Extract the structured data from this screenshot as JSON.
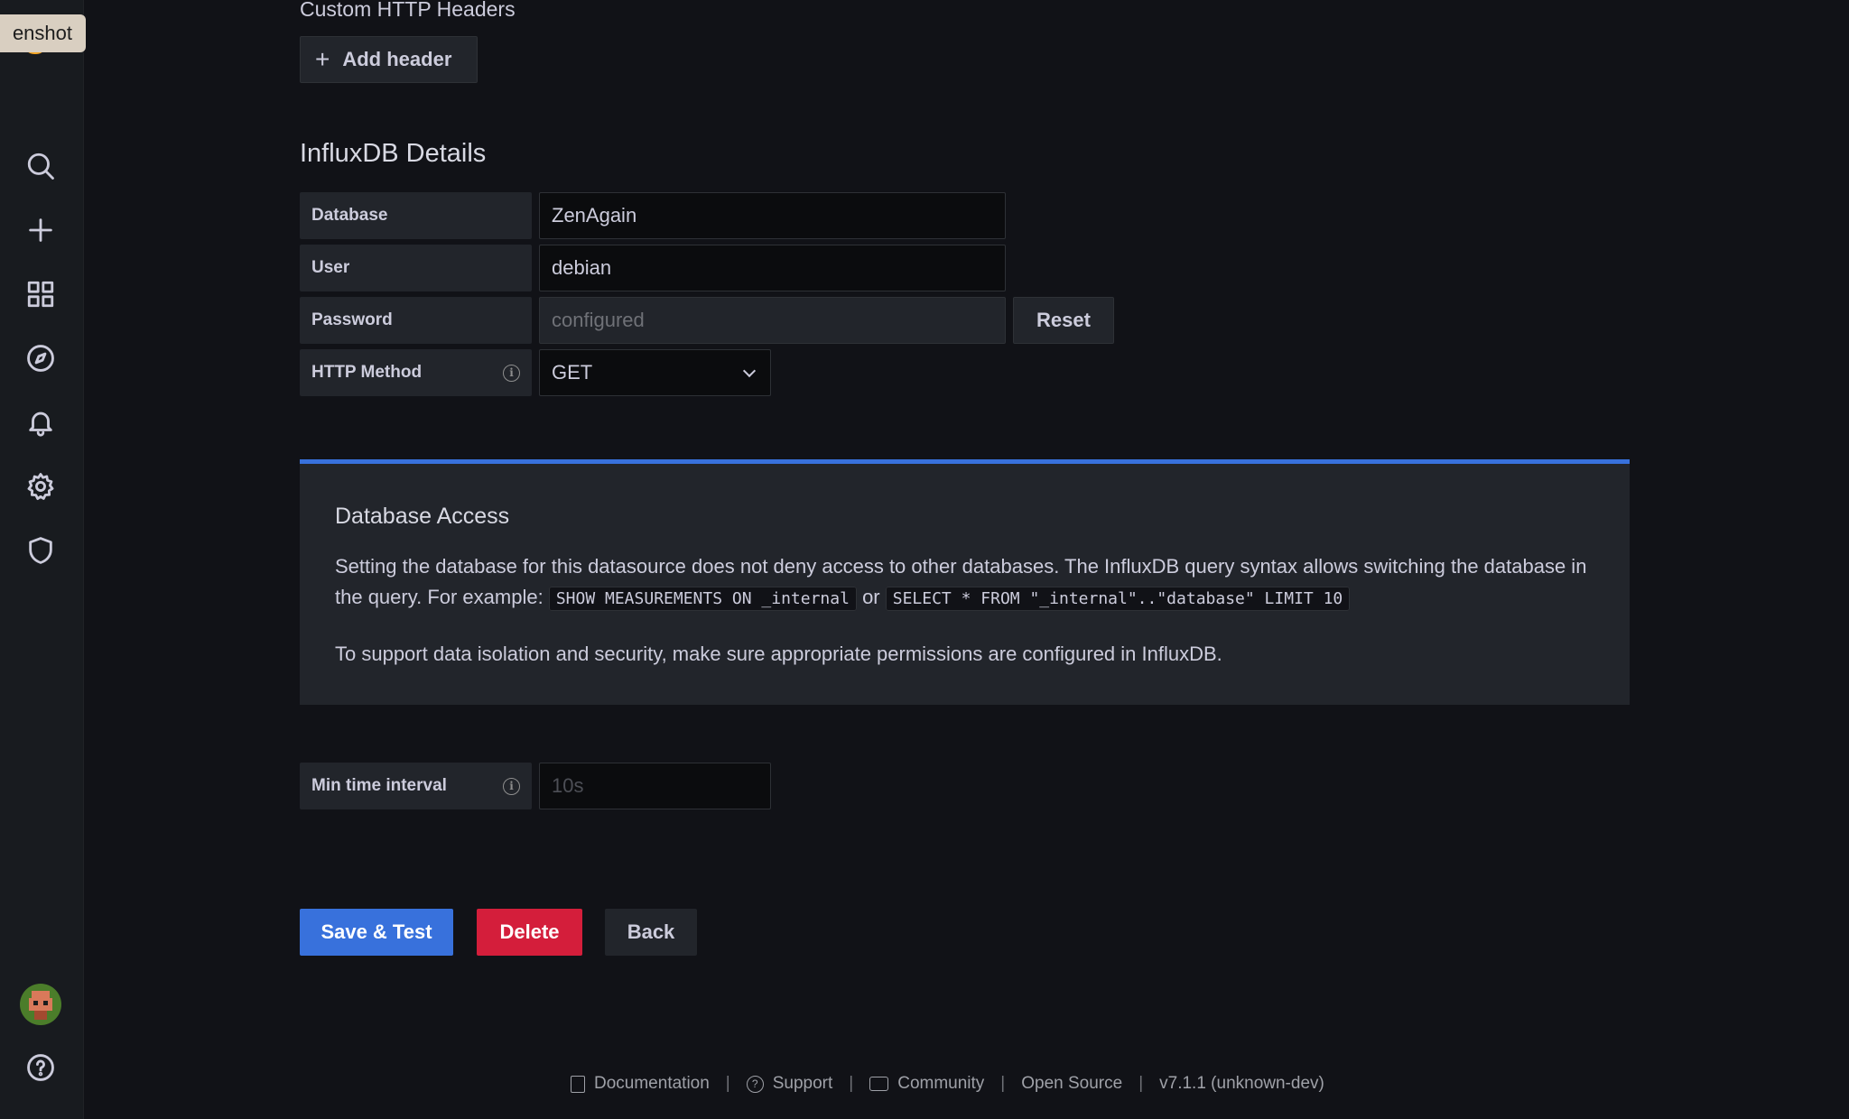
{
  "tooltip": "enshot",
  "sidebar": {
    "icons": [
      "search-icon",
      "plus-icon",
      "dashboards-icon",
      "explore-compass-icon",
      "alerting-bell-icon",
      "configuration-gear-icon",
      "server-admin-shield-icon",
      "avatar",
      "help-icon"
    ]
  },
  "custom_headers": {
    "section_label": "Custom HTTP Headers",
    "add_button": "Add header"
  },
  "influx": {
    "heading": "InfluxDB Details",
    "database_label": "Database",
    "database_value": "ZenAgain",
    "user_label": "User",
    "user_value": "debian",
    "password_label": "Password",
    "password_value": "configured",
    "reset_button": "Reset",
    "http_method_label": "HTTP Method",
    "http_method_value": "GET"
  },
  "access": {
    "title": "Database Access",
    "text_part1": "Setting the database for this datasource does not deny access to other databases. The InfluxDB query syntax allows switching the database in the query. For example:",
    "code1": "SHOW MEASUREMENTS ON _internal",
    "or": "or",
    "code2": "SELECT * FROM \"_internal\"..\"database\" LIMIT 10",
    "text2": "To support data isolation and security, make sure appropriate permissions are configured in InfluxDB."
  },
  "min_interval": {
    "label": "Min time interval",
    "placeholder": "10s"
  },
  "actions": {
    "save": "Save & Test",
    "delete": "Delete",
    "back": "Back"
  },
  "footer": {
    "documentation": "Documentation",
    "support": "Support",
    "community": "Community",
    "open_source": "Open Source",
    "version": "v7.1.1 (unknown-dev)",
    "separator": "|"
  },
  "colors": {
    "primary": "#3871dc",
    "danger": "#d41e3b",
    "background": "#111217",
    "panel": "#22252b"
  }
}
